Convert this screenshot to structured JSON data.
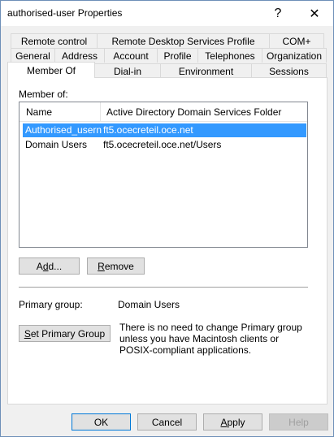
{
  "window": {
    "title": "authorised-user Properties",
    "help_glyph": "?",
    "close_glyph": "✕"
  },
  "tabs": {
    "row1": [
      {
        "label": "Remote control"
      },
      {
        "label": "Remote Desktop Services Profile"
      },
      {
        "label": "COM+"
      }
    ],
    "row2": [
      {
        "label": "General"
      },
      {
        "label": "Address"
      },
      {
        "label": "Account"
      },
      {
        "label": "Profile"
      },
      {
        "label": "Telephones"
      },
      {
        "label": "Organization"
      }
    ],
    "row3": [
      {
        "label": "Member Of"
      },
      {
        "label": "Dial-in"
      },
      {
        "label": "Environment"
      },
      {
        "label": "Sessions"
      }
    ],
    "active": "Member Of"
  },
  "member_of": {
    "label": "Member of:",
    "columns": [
      "Name",
      "Active Directory Domain Services Folder"
    ],
    "rows": [
      {
        "name": "Authorised_usern...",
        "folder": "ft5.ocecreteil.oce.net",
        "selected": true
      },
      {
        "name": "Domain Users",
        "folder": "ft5.ocecreteil.oce.net/Users",
        "selected": false
      }
    ],
    "add_label_prefix": "A",
    "add_label_underlined": "d",
    "add_label_suffix": "d...",
    "remove_label_underlined": "R",
    "remove_label_suffix": "emove"
  },
  "primary_group": {
    "label": "Primary group:",
    "value": "Domain Users",
    "set_button_underlined": "S",
    "set_button_suffix": "et Primary Group",
    "note": "There is no need to change Primary group unless you have Macintosh clients or POSIX-compliant applications."
  },
  "footer": {
    "ok": "OK",
    "cancel": "Cancel",
    "apply_underlined": "A",
    "apply_suffix": "pply",
    "help": "Help"
  },
  "colors": {
    "selection": "#3399ff",
    "window_border": "#6d8fb8",
    "default_button_border": "#0078d7"
  }
}
